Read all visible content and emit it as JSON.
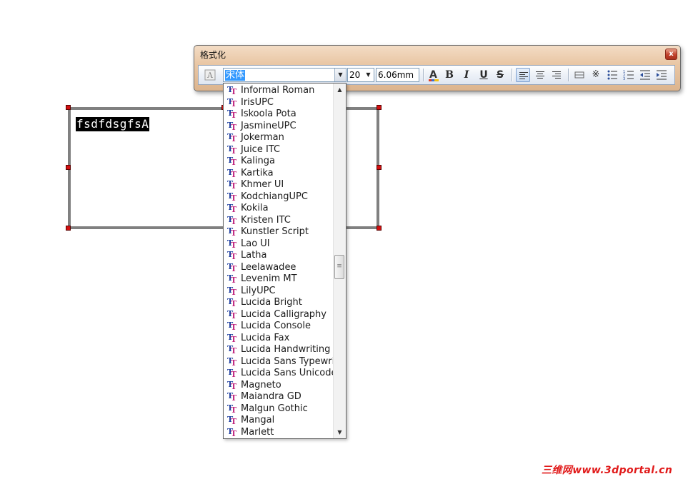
{
  "canvas": {
    "selected_text": "fsdfdsgfsA"
  },
  "toolbar_window": {
    "title": "格式化",
    "close_glyph": "x",
    "font_name": "宋体",
    "font_size": "20",
    "spacing": "6.06mm",
    "icons": {
      "char_style": "font-style-icon",
      "font_color": "font-color-icon",
      "bold": "B",
      "italic": "I",
      "underline": "U",
      "strikethrough": "S"
    }
  },
  "font_list": {
    "items": [
      "Informal Roman",
      "IrisUPC",
      "Iskoola Pota",
      "JasmineUPC",
      "Jokerman",
      "Juice ITC",
      "Kalinga",
      "Kartika",
      "Khmer UI",
      "KodchiangUPC",
      "Kokila",
      "Kristen ITC",
      "Kunstler Script",
      "Lao UI",
      "Latha",
      "Leelawadee",
      "Levenim MT",
      "LilyUPC",
      "Lucida Bright",
      "Lucida Calligraphy",
      "Lucida Console",
      "Lucida Fax",
      "Lucida Handwriting",
      "Lucida Sans Typewriter",
      "Lucida Sans Unicode",
      "Magneto",
      "Maiandra GD",
      "Malgun Gothic",
      "Mangal",
      "Marlett"
    ]
  },
  "watermark": "三维网www.3dportal.cn"
}
